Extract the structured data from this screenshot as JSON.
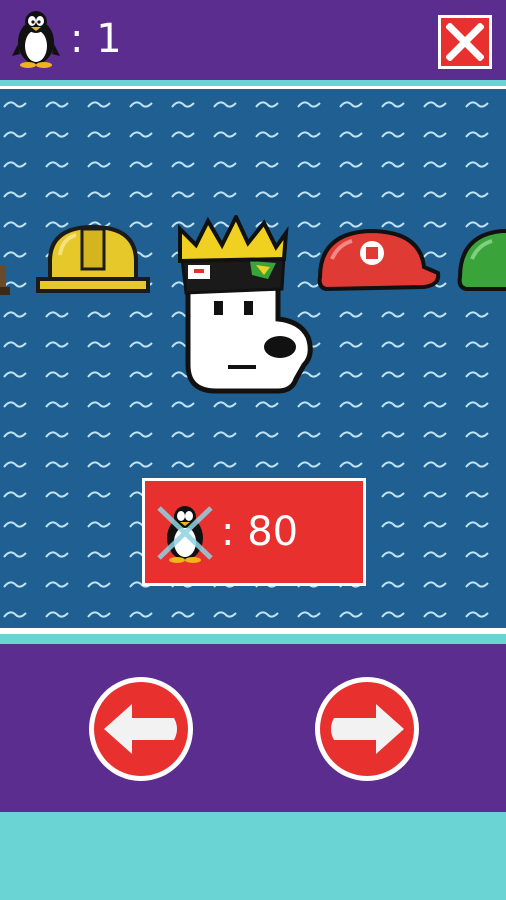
{
  "header": {
    "penguin_count": ": 1",
    "close_icon": "close-x-icon"
  },
  "hats": {
    "items": [
      "brown-hat",
      "hard-hat",
      "crown-bandana-hat",
      "red-cap",
      "green-cap"
    ],
    "selected": "crown-bandana-hat"
  },
  "price": {
    "label": ": 80",
    "currency_icon": "penguin-crossed-icon"
  },
  "controls": {
    "prev_icon": "arrow-left-icon",
    "next_icon": "arrow-right-icon"
  },
  "colors": {
    "purple": "#5b2d8e",
    "sea": "#1f5f92",
    "red": "#e8312f",
    "teal": "#6ad4d4"
  }
}
